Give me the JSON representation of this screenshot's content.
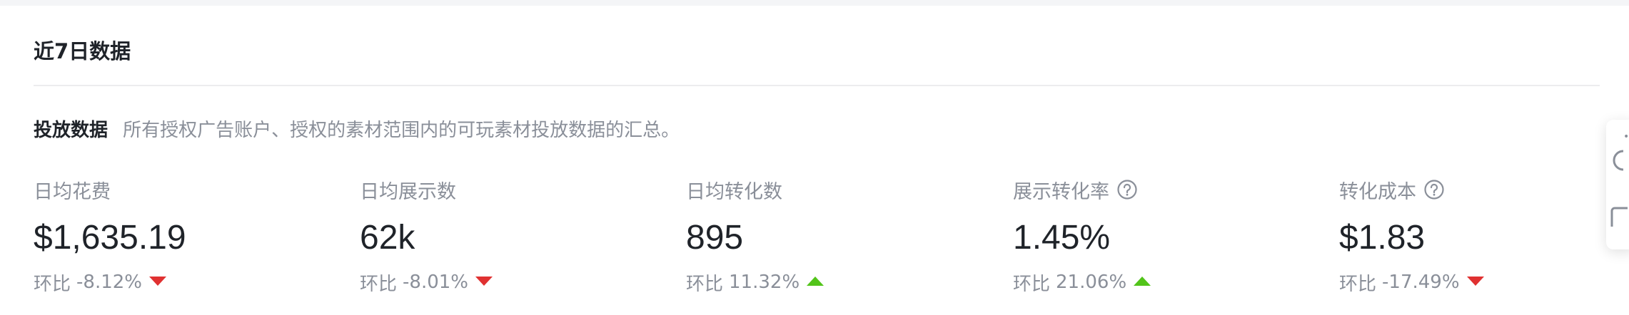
{
  "header": {
    "title": "近7日数据"
  },
  "section": {
    "title": "投放数据",
    "description": "所有授权广告账户、授权的素材范围内的可玩素材投放数据的汇总。"
  },
  "metrics": [
    {
      "label": "日均花费",
      "value": "$1,635.19",
      "change_label": "环比",
      "change_value": "-8.12%",
      "trend": "down",
      "has_help": false
    },
    {
      "label": "日均展示数",
      "value": "62k",
      "change_label": "环比",
      "change_value": "-8.01%",
      "trend": "down",
      "has_help": false
    },
    {
      "label": "日均转化数",
      "value": "895",
      "change_label": "环比",
      "change_value": "11.32%",
      "trend": "up",
      "has_help": false
    },
    {
      "label": "展示转化率",
      "value": "1.45%",
      "change_label": "环比",
      "change_value": "21.06%",
      "trend": "up",
      "has_help": true
    },
    {
      "label": "转化成本",
      "value": "$1.83",
      "change_label": "环比",
      "change_value": "-17.49%",
      "trend": "down",
      "has_help": true
    }
  ],
  "colors": {
    "trend_down": "#e03131",
    "trend_up": "#52c41a",
    "muted_text": "#8a8f99",
    "primary_text": "#1f2329"
  },
  "side_widget": {
    "icons": [
      "help-circle-icon",
      "bookmark-icon"
    ]
  }
}
